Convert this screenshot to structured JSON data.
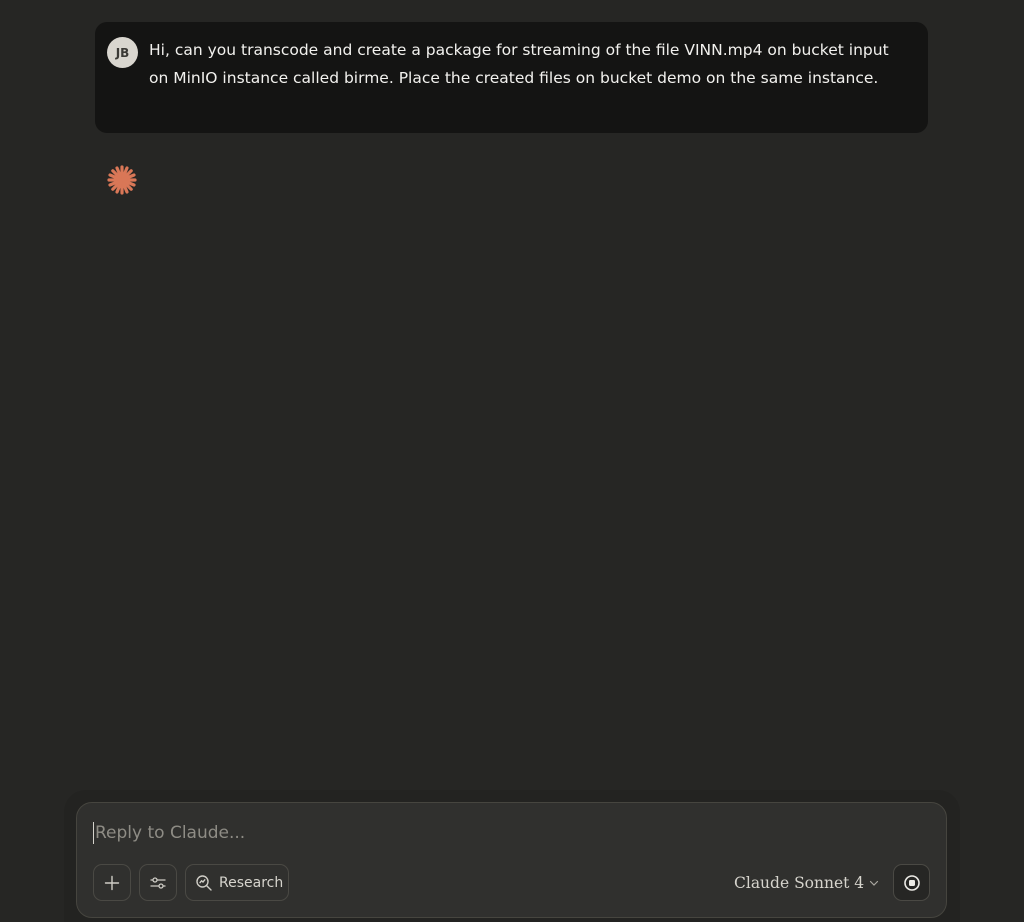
{
  "conversation": {
    "user_message": {
      "avatar_initials": "JB",
      "text": "Hi, can you transcode and create a package for streaming of the file VINN.mp4 on bucket input on MinIO instance called birme. Place the created files on bucket demo on the same instance."
    },
    "assistant_status_icon": "claude-spark-icon"
  },
  "composer": {
    "placeholder": "Reply to Claude...",
    "add_icon": "plus-icon",
    "tools_icon": "sliders-icon",
    "research_label": "Research",
    "research_icon": "research-search-icon",
    "model_label": "Claude Sonnet 4",
    "stop_icon": "stop-icon"
  },
  "colors": {
    "background": "#262624",
    "user_bubble": "#141413",
    "accent_spark": "#d97757",
    "composer": "#30302e"
  }
}
